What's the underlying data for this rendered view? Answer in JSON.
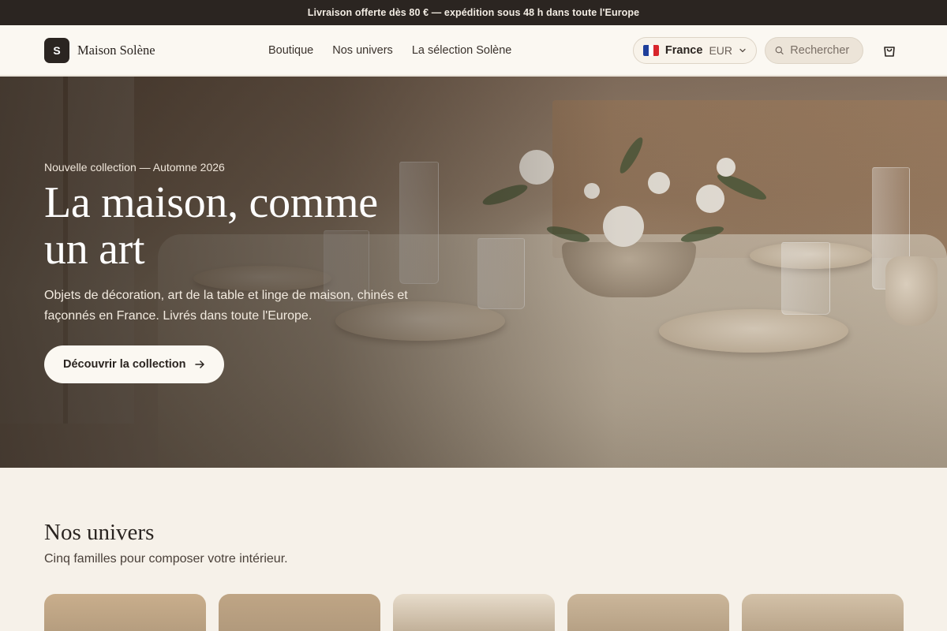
{
  "announcement": "Livraison offerte dès 80 € — expédition sous 48 h dans toute l'Europe",
  "brand": {
    "mark": "S",
    "name": "Maison Solène"
  },
  "nav": [
    {
      "label": "Boutique"
    },
    {
      "label": "Nos univers"
    },
    {
      "label": "La sélection Solène"
    }
  ],
  "locale": {
    "country": "France",
    "currency": "EUR"
  },
  "search": {
    "placeholder": "Rechercher"
  },
  "icons": {
    "flag": "france-flag-icon",
    "chevron": "chevron-down-icon",
    "search": "search-icon",
    "cart": "shopping-bag-icon",
    "arrow": "arrow-right-icon"
  },
  "hero": {
    "eyebrow": "Nouvelle collection — Automne 2026",
    "title_line1": "La maison, comme",
    "title_line2": "un art",
    "subtitle": "Objets de décoration, art de la table et linge de maison, chinés et façonnés en France. Livrés dans toute l'Europe.",
    "cta": "Découvrir la collection"
  },
  "universes": {
    "title": "Nos univers",
    "subtitle": "Cinq familles pour composer votre intérieur.",
    "cards": [
      {
        "color": "#c9ae8c"
      },
      {
        "color": "#bfa585"
      },
      {
        "color": "#e7dccb"
      },
      {
        "color": "#cbb69a"
      },
      {
        "color": "#d3c1a8"
      }
    ]
  },
  "colors": {
    "dark": "#2b2521",
    "cream": "#fbf8f2",
    "background": "#f6f1e9"
  }
}
